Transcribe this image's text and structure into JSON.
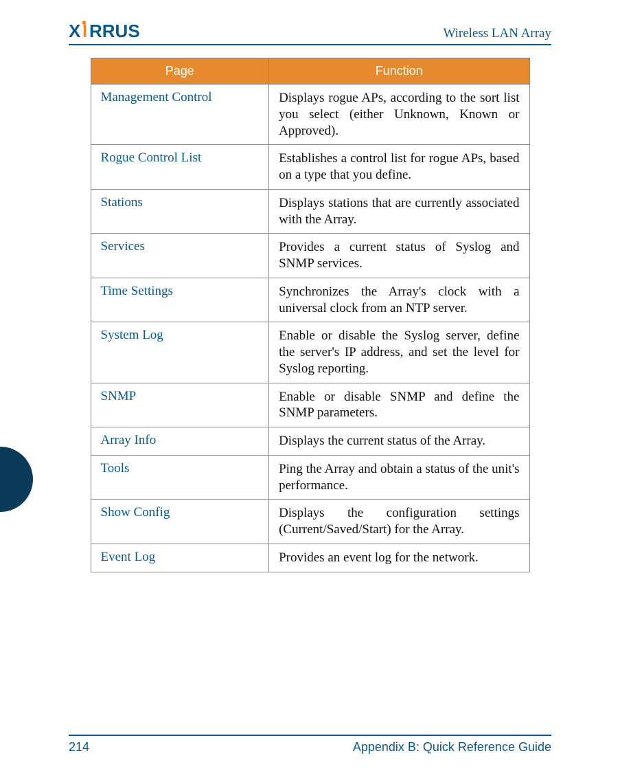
{
  "header": {
    "logo_text": "XIRRUS",
    "product": "Wireless LAN Array"
  },
  "table": {
    "headers": {
      "page": "Page",
      "function": "Function"
    },
    "rows": [
      {
        "page": "Management Control",
        "function": "Displays rogue APs, according to the sort list you select (either Unknown, Known or Approved)."
      },
      {
        "page": "Rogue Control List",
        "function": "Establishes a control list for rogue APs, based on a type that you define."
      },
      {
        "page": "Stations",
        "function": "Displays stations that are currently associated with the Array."
      },
      {
        "page": "Services",
        "function": "Provides a current status of Syslog and SNMP services."
      },
      {
        "page": "Time Settings",
        "function": "Synchronizes the Array's clock with a universal clock from an NTP server."
      },
      {
        "page": "System Log",
        "function": "Enable or disable the Syslog server, define the server's IP address, and set the level for Syslog reporting."
      },
      {
        "page": "SNMP",
        "function": "Enable or disable SNMP and define the SNMP parameters."
      },
      {
        "page": "Array Info",
        "function": "Displays the current status of the Array."
      },
      {
        "page": "Tools",
        "function": "Ping the Array and obtain a status of the unit's performance."
      },
      {
        "page": "Show Config",
        "function": "Displays the configuration settings (Current/Saved/Start) for the Array."
      },
      {
        "page": "Event Log",
        "function": "Provides an event log for the network."
      }
    ]
  },
  "footer": {
    "page_number": "214",
    "section": "Appendix B: Quick Reference Guide"
  }
}
